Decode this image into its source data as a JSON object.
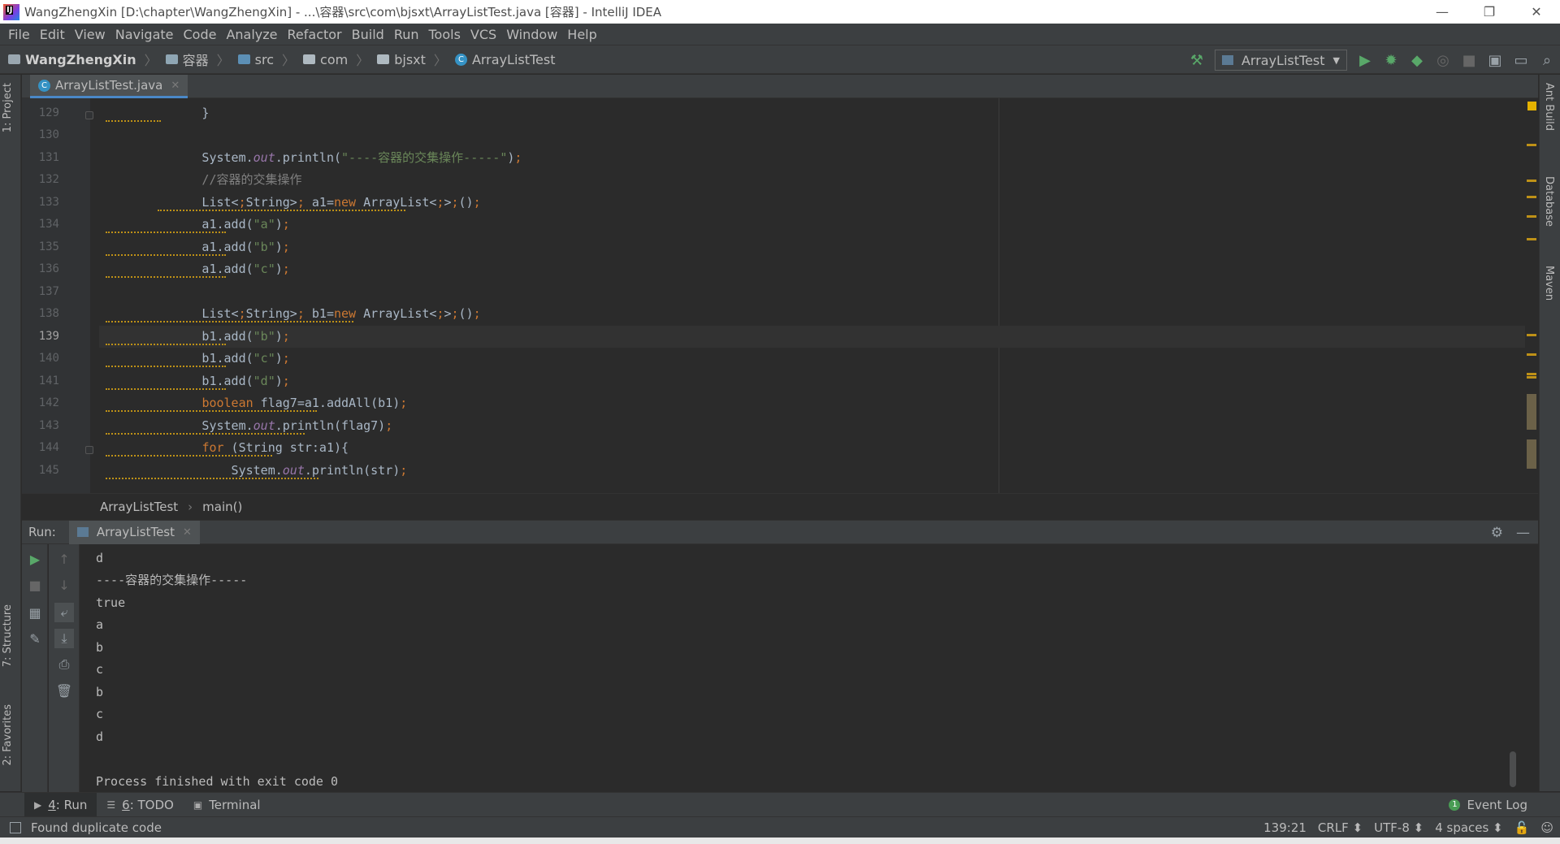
{
  "window": {
    "title": "WangZhengXin [D:\\chapter\\WangZhengXin] - ...\\容器\\src\\com\\bjsxt\\ArrayListTest.java [容器] - IntelliJ IDEA",
    "minimize": "—",
    "restore": "❐",
    "close": "✕"
  },
  "menu": [
    "File",
    "Edit",
    "View",
    "Navigate",
    "Code",
    "Analyze",
    "Refactor",
    "Build",
    "Run",
    "Tools",
    "VCS",
    "Window",
    "Help"
  ],
  "breadcrumbs": [
    "WangZhengXin",
    "容器",
    "src",
    "com",
    "bjsxt",
    "ArrayListTest"
  ],
  "toolbar": {
    "run_config": "ArrayListTest",
    "icons": [
      "hammer-icon",
      "run-icon",
      "debug-icon",
      "coverage-icon",
      "profile-icon",
      "stop-icon",
      "project-structure-icon",
      "layout-icon",
      "search-icon"
    ]
  },
  "left_tabs": {
    "project": "1: Project",
    "structure": "7: Structure",
    "favorites": "2: Favorites"
  },
  "right_tabs": {
    "ant": "Ant Build",
    "database": "Database",
    "maven": "Maven"
  },
  "editor": {
    "tab_label": "ArrayListTest.java",
    "current_line": "139",
    "lines": [
      {
        "n": "129",
        "text": "        }"
      },
      {
        "n": "130",
        "text": ""
      },
      {
        "n": "131",
        "text": "        System.out.println(\"----容器的交集操作-----\");"
      },
      {
        "n": "132",
        "text": "        //容器的交集操作"
      },
      {
        "n": "133",
        "text": "        List<String> a1=new ArrayList<>();"
      },
      {
        "n": "134",
        "text": "        a1.add(\"a\");"
      },
      {
        "n": "135",
        "text": "        a1.add(\"b\");"
      },
      {
        "n": "136",
        "text": "        a1.add(\"c\");"
      },
      {
        "n": "137",
        "text": ""
      },
      {
        "n": "138",
        "text": "        List<String> b1=new ArrayList<>();"
      },
      {
        "n": "139",
        "text": "        b1.add(\"b\");"
      },
      {
        "n": "140",
        "text": "        b1.add(\"c\");"
      },
      {
        "n": "141",
        "text": "        b1.add(\"d\");"
      },
      {
        "n": "142",
        "text": "        boolean flag7=a1.addAll(b1);"
      },
      {
        "n": "143",
        "text": "        System.out.println(flag7);"
      },
      {
        "n": "144",
        "text": "        for (String str:a1){"
      },
      {
        "n": "145",
        "text": "            System.out.println(str);"
      }
    ]
  },
  "code_breadcrumbs": [
    "ArrayListTest",
    "main()"
  ],
  "run_panel": {
    "label": "Run:",
    "tab": "ArrayListTest",
    "output": [
      "d",
      "----容器的交集操作-----",
      "true",
      "a",
      "b",
      "c",
      "b",
      "c",
      "d",
      "",
      "Process finished with exit code 0"
    ]
  },
  "bottom_tabs": [
    {
      "key": "4",
      "label": ": Run"
    },
    {
      "key": "6",
      "label": ": TODO"
    },
    {
      "key": "",
      "label": "Terminal"
    }
  ],
  "event_log": "Event Log",
  "status": {
    "message": "Found duplicate code",
    "position": "139:21",
    "line_sep": "CRLF ⬍",
    "encoding": "UTF-8 ⬍",
    "indent": "4 spaces ⬍"
  },
  "colors": {
    "bg": "#2b2b2b",
    "panel": "#3c3f41",
    "keyword": "#cc7832",
    "string": "#6a8759",
    "comment": "#808080",
    "field": "#9876aa",
    "warning": "#be9117"
  }
}
